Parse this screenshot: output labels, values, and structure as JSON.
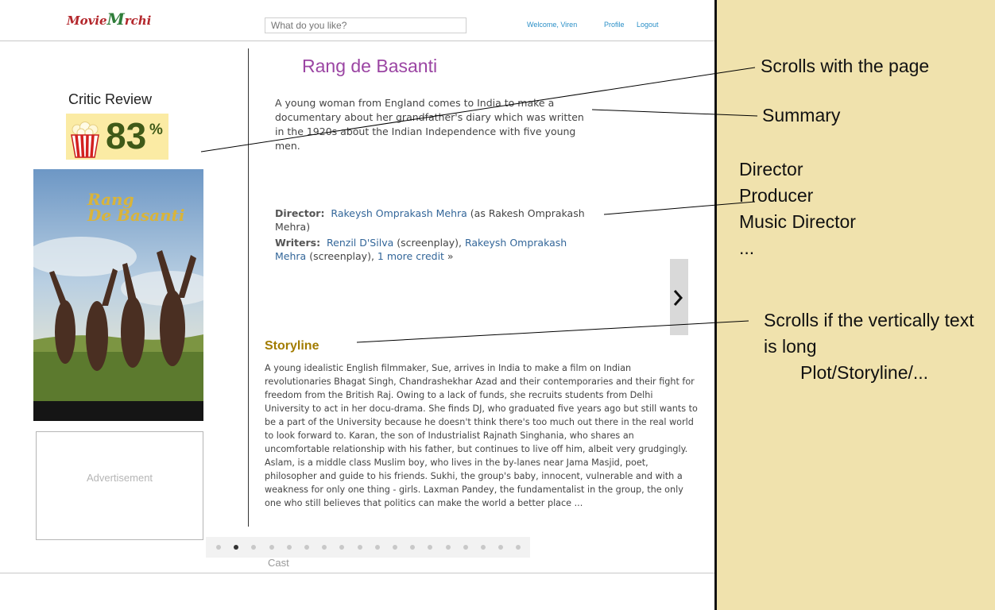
{
  "header": {
    "logo_part1": "Movie",
    "logo_part2": "M",
    "logo_part3": "rchi",
    "search_placeholder": "What do you like?",
    "welcome": "Welcome, Viren",
    "profile": "Profile",
    "logout": "Logout"
  },
  "left": {
    "critic_label": "Critic Review",
    "score": "83",
    "score_unit": "%",
    "poster_title_line1": "Rang",
    "poster_title_line2": "De Basanti",
    "ad_label": "Advertisement"
  },
  "movie": {
    "title": "Rang de Basanti",
    "summary": "A young woman from England comes to India to make a documentary about her grandfather's diary which was written in the 1920s about the Indian Independence with five young men.",
    "director_label": "Director:",
    "director_name": "Rakeysh Omprakash Mehra",
    "director_note": "(as Rakesh Omprakash Mehra)",
    "writers_label": "Writers:",
    "writer1": "Renzil D'Silva",
    "writer1_note": "(screenplay),",
    "writer2": "Rakeysh Omprakash Mehra",
    "writer2_note": "(screenplay),",
    "more_credit": "1 more credit",
    "more_credit_suffix": "»",
    "storyline_heading": "Storyline",
    "storyline": "A young idealistic English filmmaker, Sue, arrives in India to make a film on Indian revolutionaries Bhagat Singh, Chandrashekhar Azad and their contemporaries and their fight for freedom from the British Raj. Owing to a lack of funds, she recruits students from Delhi University to act in her docu-drama. She finds DJ, who graduated five years ago but still wants to be a part of the University because he doesn't think there's too much out there in the real world to look forward to. Karan, the son of Industrialist Rajnath Singhania, who shares an uncomfortable relationship with his father, but continues to live off him, albeit very grudgingly. Aslam, is a middle class Muslim boy, who lives in the by-lanes near Jama Masjid, poet, philosopher and guide to his friends. Sukhi, the group's baby, innocent, vulnerable and with a weakness for only one thing - girls. Laxman Pandey, the fundamentalist in the group, the only one who still believes that politics can make the world a better place ...",
    "cast_label": "Cast",
    "carousel": {
      "pages": 18,
      "active_index": 1
    }
  },
  "annotations": {
    "scrolls": "Scrolls with the page",
    "summary": "Summary",
    "roles": [
      "Director",
      "Producer",
      "Music Director",
      "..."
    ],
    "scroll_long_1": "Scrolls if the vertically text",
    "scroll_long_2": "is long",
    "plot": "Plot/Storyline/..."
  },
  "colors": {
    "title": "#9b45a3",
    "link": "#336699",
    "nav_link": "#2a8fc7",
    "storyline_heading": "#a27c00",
    "score": "#3f5a18",
    "annotation_bg": "#f0e2ad"
  }
}
